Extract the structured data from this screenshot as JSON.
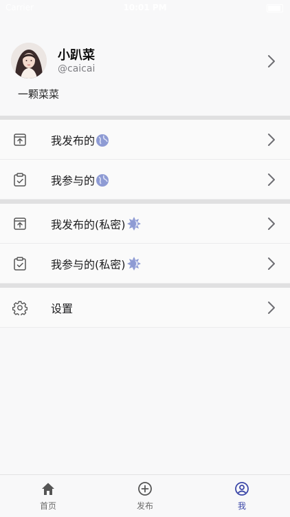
{
  "status_bar": {
    "carrier": "Carrier",
    "time": "10:01 PM"
  },
  "profile": {
    "nickname": "小趴菜",
    "handle": "@caicai",
    "bio": "一颗菜菜"
  },
  "menu_public": [
    {
      "label": "我发布的",
      "icon": "archive-upload-icon",
      "badge": "globe-icon"
    },
    {
      "label": "我参与的",
      "icon": "clipboard-check-icon",
      "badge": "globe-icon"
    }
  ],
  "menu_private": [
    {
      "label": "我发布的(私密)",
      "icon": "archive-upload-icon",
      "badge": "private-sun-icon"
    },
    {
      "label": "我参与的(私密)",
      "icon": "clipboard-check-icon",
      "badge": "private-sun-icon"
    }
  ],
  "menu_settings": {
    "label": "设置",
    "icon": "gear-icon"
  },
  "tabbar": {
    "items": [
      {
        "label": "首页",
        "icon": "home-icon"
      },
      {
        "label": "发布",
        "icon": "plus-circle-icon"
      },
      {
        "label": "我",
        "icon": "user-circle-icon"
      }
    ],
    "active_color": "#3b47a8",
    "inactive_color": "#6b6b6b"
  },
  "colors": {
    "badge": "#8e9bd4",
    "divider": "#e0e0e1",
    "background": "#f8f8f9"
  }
}
